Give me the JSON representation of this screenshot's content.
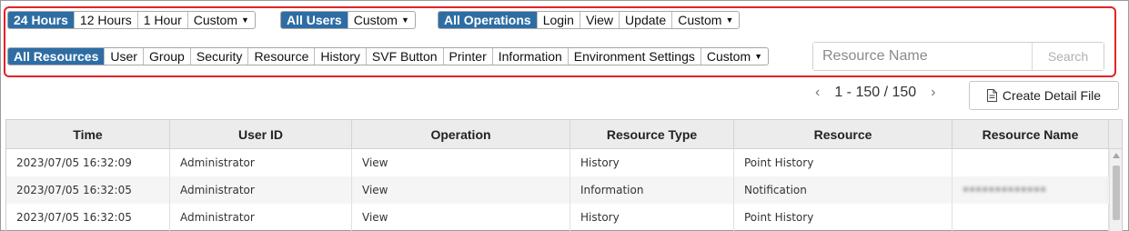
{
  "filters": {
    "time": {
      "options": [
        "24 Hours",
        "12 Hours",
        "1 Hour"
      ],
      "custom": "Custom",
      "active_index": 0
    },
    "users": {
      "options": [
        "All Users"
      ],
      "custom": "Custom",
      "active_index": 0
    },
    "operations": {
      "options": [
        "All Operations",
        "Login",
        "View",
        "Update"
      ],
      "custom": "Custom",
      "active_index": 0
    },
    "resources": {
      "options": [
        "All Resources",
        "User",
        "Group",
        "Security",
        "Resource",
        "History",
        "SVF Button",
        "Printer",
        "Information",
        "Environment Settings"
      ],
      "custom": "Custom",
      "active_index": 0
    }
  },
  "search": {
    "placeholder": "Resource Name",
    "value": "",
    "button_label": "Search"
  },
  "pagination": {
    "prev_glyph": "‹",
    "next_glyph": "›",
    "range_label": "1 - 150 / 150"
  },
  "create_detail_file": {
    "label": "Create Detail File",
    "icon": "document-icon"
  },
  "table": {
    "columns": [
      "Time",
      "User ID",
      "Operation",
      "Resource Type",
      "Resource",
      "Resource Name"
    ],
    "rows": [
      [
        "2023/07/05 16:32:09",
        "Administrator",
        "View",
        "History",
        "Point History",
        ""
      ],
      [
        "2023/07/05 16:32:05",
        "Administrator",
        "View",
        "Information",
        "Notification",
        "•••••••••••••"
      ],
      [
        "2023/07/05 16:32:05",
        "Administrator",
        "View",
        "History",
        "Point History",
        ""
      ]
    ]
  },
  "colors": {
    "active_segment": "#2e6da4",
    "highlight_border": "#e0242a",
    "header_bg": "#ececec"
  }
}
